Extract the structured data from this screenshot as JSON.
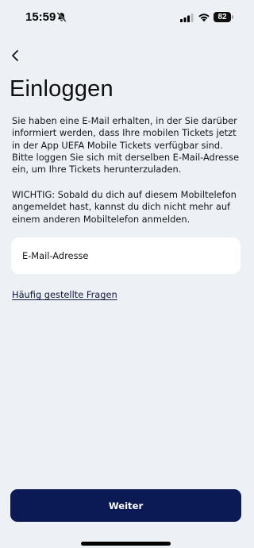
{
  "status_bar": {
    "time": "15:59",
    "battery_level": "82",
    "icons": [
      "bell-slash-icon",
      "signal-icon",
      "wifi-icon",
      "battery-icon"
    ]
  },
  "header": {
    "back_icon": "chevron-left-icon",
    "title": "Einloggen"
  },
  "content": {
    "intro": "Sie haben eine E-Mail erhalten, in der Sie darüber informiert werden, dass Ihre mobilen Tickets jetzt in der App UEFA Mobile Tickets verfügbar sind. Bitte loggen Sie sich mit derselben E-Mail-Adresse ein, um Ihre Tickets herunterzuladen.",
    "warning": "WICHTIG: Sobald du dich auf diesem Mobiltelefon angemeldet hast, kannst du dich nicht mehr auf einem anderen Mobiltelefon anmelden.",
    "email_placeholder": "E-Mail-Adresse",
    "email_value": "",
    "faq_link": "Häufig gestellte Fragen"
  },
  "footer": {
    "continue_label": "Weiter"
  },
  "colors": {
    "background": "#edf0f4",
    "primary_button": "#0b1a55",
    "field_background": "#ffffff",
    "text": "#111418"
  }
}
